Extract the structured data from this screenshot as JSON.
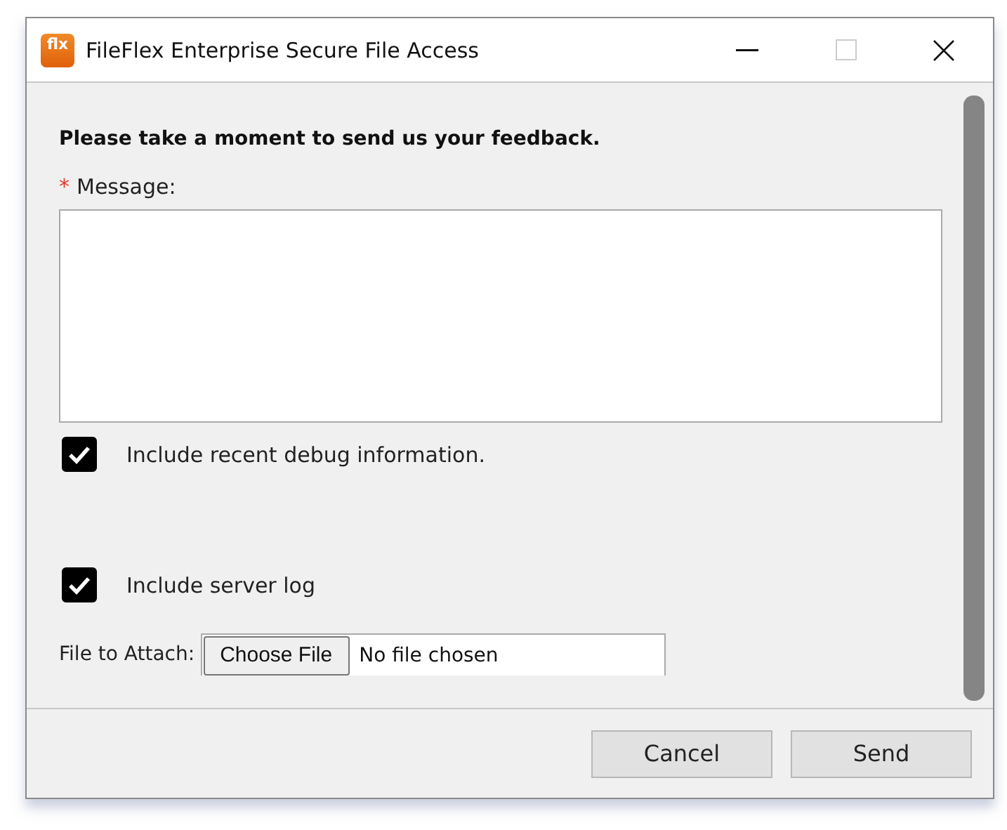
{
  "window": {
    "logo_text": "flx",
    "title": "FileFlex Enterprise Secure File Access"
  },
  "heading": "Please take a moment to send us your feedback.",
  "message": {
    "required_mark": "*",
    "label": "Message:"
  },
  "checkboxes": [
    {
      "label": "Include recent debug information.",
      "checked": true
    },
    {
      "label": "Include server log",
      "checked": true
    }
  ],
  "file": {
    "label": "File to Attach:",
    "button": "Choose File",
    "status": "No file chosen"
  },
  "buttons": [
    "Cancel",
    "Send"
  ]
}
